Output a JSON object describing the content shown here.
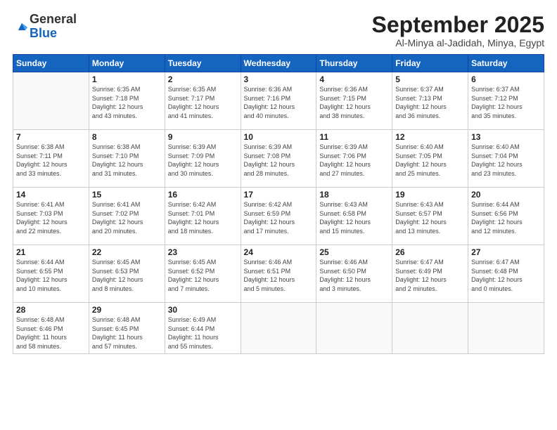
{
  "logo": {
    "general": "General",
    "blue": "Blue"
  },
  "header": {
    "month": "September 2025",
    "location": "Al-Minya al-Jadidah, Minya, Egypt"
  },
  "weekdays": [
    "Sunday",
    "Monday",
    "Tuesday",
    "Wednesday",
    "Thursday",
    "Friday",
    "Saturday"
  ],
  "weeks": [
    [
      {
        "day": "",
        "info": ""
      },
      {
        "day": "1",
        "info": "Sunrise: 6:35 AM\nSunset: 7:18 PM\nDaylight: 12 hours\nand 43 minutes."
      },
      {
        "day": "2",
        "info": "Sunrise: 6:35 AM\nSunset: 7:17 PM\nDaylight: 12 hours\nand 41 minutes."
      },
      {
        "day": "3",
        "info": "Sunrise: 6:36 AM\nSunset: 7:16 PM\nDaylight: 12 hours\nand 40 minutes."
      },
      {
        "day": "4",
        "info": "Sunrise: 6:36 AM\nSunset: 7:15 PM\nDaylight: 12 hours\nand 38 minutes."
      },
      {
        "day": "5",
        "info": "Sunrise: 6:37 AM\nSunset: 7:13 PM\nDaylight: 12 hours\nand 36 minutes."
      },
      {
        "day": "6",
        "info": "Sunrise: 6:37 AM\nSunset: 7:12 PM\nDaylight: 12 hours\nand 35 minutes."
      }
    ],
    [
      {
        "day": "7",
        "info": "Sunrise: 6:38 AM\nSunset: 7:11 PM\nDaylight: 12 hours\nand 33 minutes."
      },
      {
        "day": "8",
        "info": "Sunrise: 6:38 AM\nSunset: 7:10 PM\nDaylight: 12 hours\nand 31 minutes."
      },
      {
        "day": "9",
        "info": "Sunrise: 6:39 AM\nSunset: 7:09 PM\nDaylight: 12 hours\nand 30 minutes."
      },
      {
        "day": "10",
        "info": "Sunrise: 6:39 AM\nSunset: 7:08 PM\nDaylight: 12 hours\nand 28 minutes."
      },
      {
        "day": "11",
        "info": "Sunrise: 6:39 AM\nSunset: 7:06 PM\nDaylight: 12 hours\nand 27 minutes."
      },
      {
        "day": "12",
        "info": "Sunrise: 6:40 AM\nSunset: 7:05 PM\nDaylight: 12 hours\nand 25 minutes."
      },
      {
        "day": "13",
        "info": "Sunrise: 6:40 AM\nSunset: 7:04 PM\nDaylight: 12 hours\nand 23 minutes."
      }
    ],
    [
      {
        "day": "14",
        "info": "Sunrise: 6:41 AM\nSunset: 7:03 PM\nDaylight: 12 hours\nand 22 minutes."
      },
      {
        "day": "15",
        "info": "Sunrise: 6:41 AM\nSunset: 7:02 PM\nDaylight: 12 hours\nand 20 minutes."
      },
      {
        "day": "16",
        "info": "Sunrise: 6:42 AM\nSunset: 7:01 PM\nDaylight: 12 hours\nand 18 minutes."
      },
      {
        "day": "17",
        "info": "Sunrise: 6:42 AM\nSunset: 6:59 PM\nDaylight: 12 hours\nand 17 minutes."
      },
      {
        "day": "18",
        "info": "Sunrise: 6:43 AM\nSunset: 6:58 PM\nDaylight: 12 hours\nand 15 minutes."
      },
      {
        "day": "19",
        "info": "Sunrise: 6:43 AM\nSunset: 6:57 PM\nDaylight: 12 hours\nand 13 minutes."
      },
      {
        "day": "20",
        "info": "Sunrise: 6:44 AM\nSunset: 6:56 PM\nDaylight: 12 hours\nand 12 minutes."
      }
    ],
    [
      {
        "day": "21",
        "info": "Sunrise: 6:44 AM\nSunset: 6:55 PM\nDaylight: 12 hours\nand 10 minutes."
      },
      {
        "day": "22",
        "info": "Sunrise: 6:45 AM\nSunset: 6:53 PM\nDaylight: 12 hours\nand 8 minutes."
      },
      {
        "day": "23",
        "info": "Sunrise: 6:45 AM\nSunset: 6:52 PM\nDaylight: 12 hours\nand 7 minutes."
      },
      {
        "day": "24",
        "info": "Sunrise: 6:46 AM\nSunset: 6:51 PM\nDaylight: 12 hours\nand 5 minutes."
      },
      {
        "day": "25",
        "info": "Sunrise: 6:46 AM\nSunset: 6:50 PM\nDaylight: 12 hours\nand 3 minutes."
      },
      {
        "day": "26",
        "info": "Sunrise: 6:47 AM\nSunset: 6:49 PM\nDaylight: 12 hours\nand 2 minutes."
      },
      {
        "day": "27",
        "info": "Sunrise: 6:47 AM\nSunset: 6:48 PM\nDaylight: 12 hours\nand 0 minutes."
      }
    ],
    [
      {
        "day": "28",
        "info": "Sunrise: 6:48 AM\nSunset: 6:46 PM\nDaylight: 11 hours\nand 58 minutes."
      },
      {
        "day": "29",
        "info": "Sunrise: 6:48 AM\nSunset: 6:45 PM\nDaylight: 11 hours\nand 57 minutes."
      },
      {
        "day": "30",
        "info": "Sunrise: 6:49 AM\nSunset: 6:44 PM\nDaylight: 11 hours\nand 55 minutes."
      },
      {
        "day": "",
        "info": ""
      },
      {
        "day": "",
        "info": ""
      },
      {
        "day": "",
        "info": ""
      },
      {
        "day": "",
        "info": ""
      }
    ]
  ]
}
